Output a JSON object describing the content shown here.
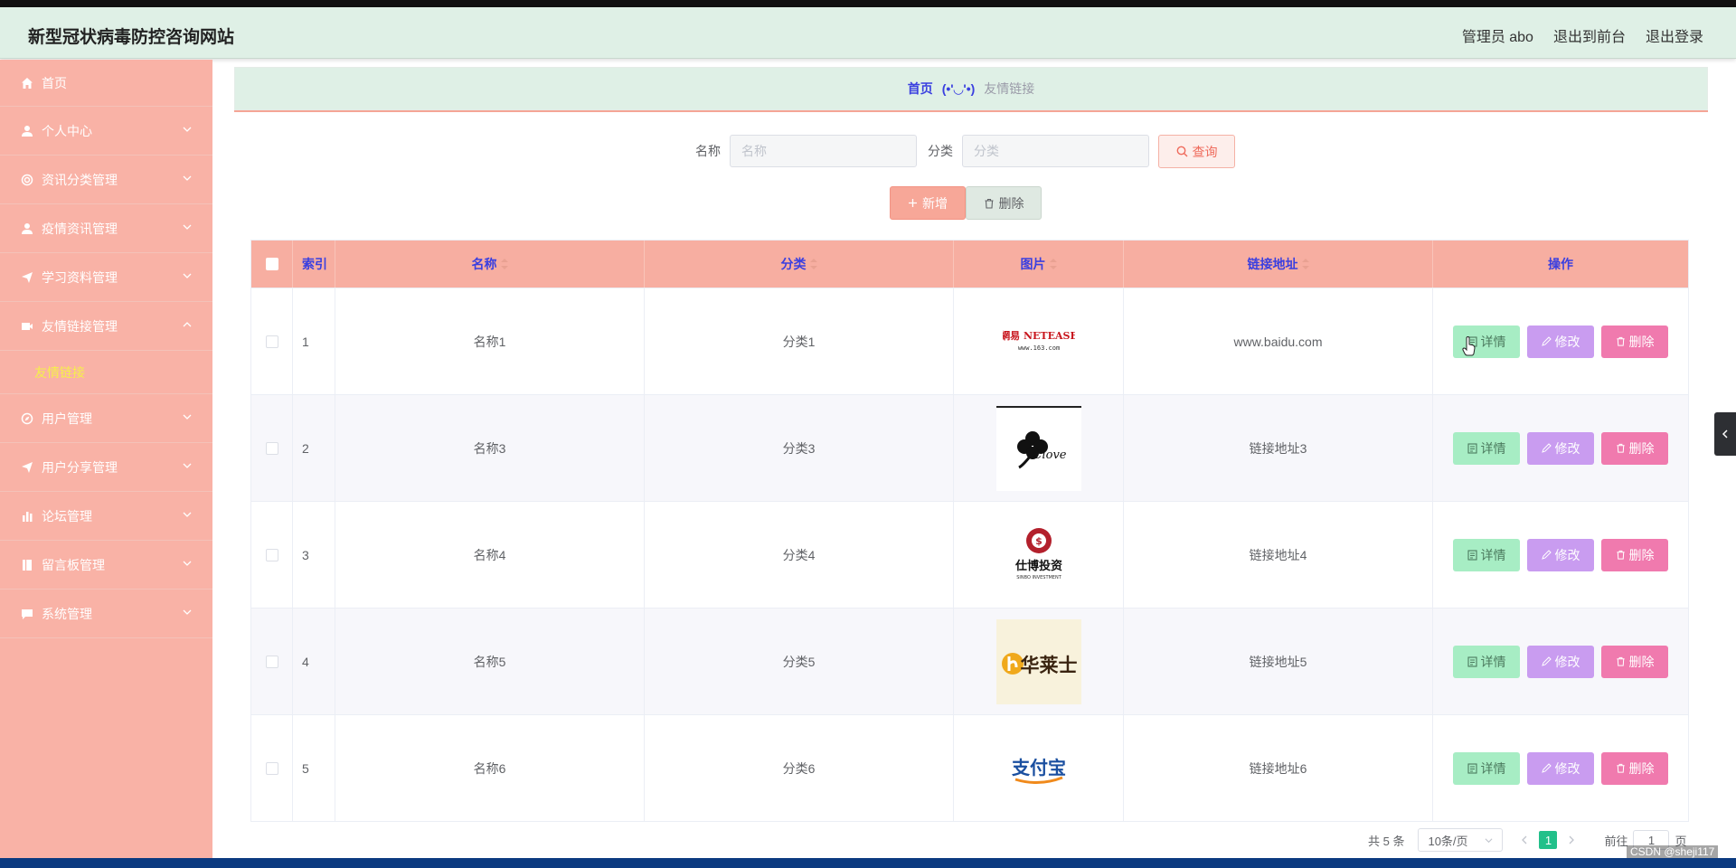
{
  "app": {
    "title": "新型冠状病毒防控咨询网站"
  },
  "header": {
    "user": "管理员 abo",
    "to_front": "退出到前台",
    "logout": "退出登录"
  },
  "sidebar": {
    "items": [
      {
        "label": "首页",
        "icon": "home-icon"
      },
      {
        "label": "个人中心",
        "icon": "user-icon"
      },
      {
        "label": "资讯分类管理",
        "icon": "ring-icon"
      },
      {
        "label": "疫情资讯管理",
        "icon": "user-icon"
      },
      {
        "label": "学习资料管理",
        "icon": "send-icon"
      },
      {
        "label": "友情链接管理",
        "icon": "film-icon",
        "expanded": true
      },
      {
        "label": "用户管理",
        "icon": "compass-icon"
      },
      {
        "label": "用户分享管理",
        "icon": "send-icon"
      },
      {
        "label": "论坛管理",
        "icon": "bar-chart-icon"
      },
      {
        "label": "留言板管理",
        "icon": "book-icon"
      },
      {
        "label": "系统管理",
        "icon": "chat-icon"
      }
    ],
    "sub_item": "友情链接"
  },
  "breadcrumb": {
    "home": "首页",
    "sep": "(•'◡'•)",
    "current": "友情链接"
  },
  "search": {
    "name_label": "名称",
    "name_placeholder": "名称",
    "category_label": "分类",
    "category_placeholder": "分类",
    "query_label": "查询"
  },
  "actions": {
    "add_label": "新增",
    "delete_label": "删除"
  },
  "table": {
    "headers": {
      "index": "索引",
      "name": "名称",
      "category": "分类",
      "image": "图片",
      "url": "链接地址",
      "ops": "操作"
    },
    "rows": [
      {
        "index": "1",
        "name": "名称1",
        "category": "分类1",
        "logo": "netease-logo",
        "logo_text_1": "網易 NETEASE",
        "logo_text_2": "www.163.com",
        "url": "www.baidu.com"
      },
      {
        "index": "2",
        "name": "名称3",
        "category": "分类3",
        "logo": "clove-logo",
        "logo_text_1": "Clove",
        "url": "链接地址3"
      },
      {
        "index": "3",
        "name": "名称4",
        "category": "分类4",
        "logo": "sinbo-logo",
        "logo_text_1": "仕博投资",
        "logo_text_2": "SINBO INVESTMENT",
        "url": "链接地址4"
      },
      {
        "index": "4",
        "name": "名称5",
        "category": "分类5",
        "logo": "hualaishi-logo",
        "logo_text_1": "华莱士",
        "url": "链接地址5"
      },
      {
        "index": "5",
        "name": "名称6",
        "category": "分类6",
        "logo": "alipay-logo",
        "logo_text_1": "支付宝",
        "url": "链接地址6"
      }
    ],
    "op_labels": {
      "detail": "详情",
      "edit": "修改",
      "remove": "删除"
    }
  },
  "pagination": {
    "total": "共 5 条",
    "page_size": "10条/页",
    "current_page": "1",
    "goto_label": "前往",
    "goto_value": "1",
    "page_unit": "页"
  },
  "watermark": "CSDN @sheji117",
  "colors": {
    "sidebar": "#f9b2a6",
    "header": "#dff0e6",
    "table_header": "#f7aea1",
    "accent_text": "#3a3fe0",
    "detail": "#a7edc4",
    "edit": "#c99cf0",
    "remove": "#f07aae",
    "active_page": "#22c08a"
  }
}
